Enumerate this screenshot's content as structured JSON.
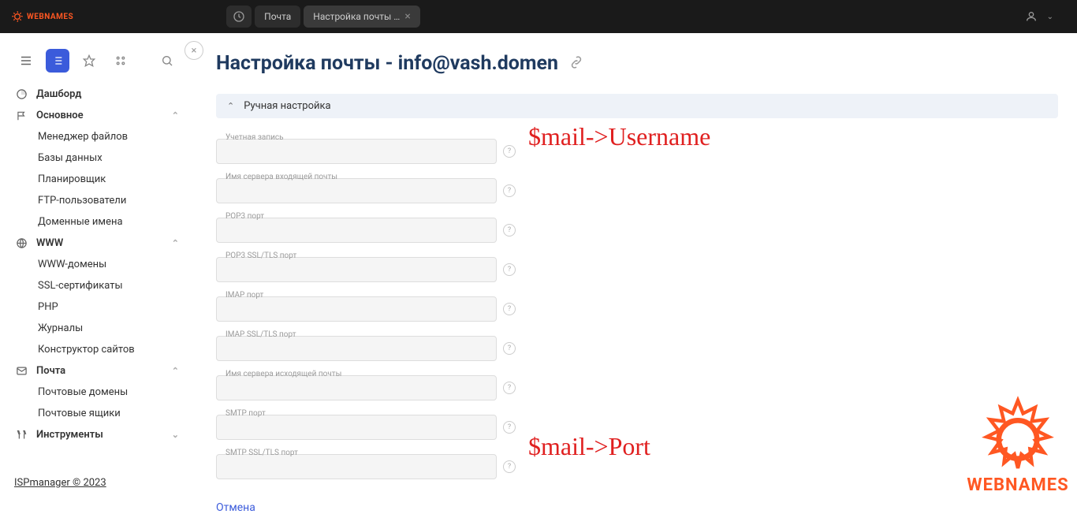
{
  "topbar": {
    "logo_text": "WEBNAMES",
    "tabs": [
      {
        "label": "Почта",
        "active": false
      },
      {
        "label": "Настройка почты …",
        "active": true
      }
    ]
  },
  "sidebar": {
    "dashboard": "Дашборд",
    "sections": [
      {
        "label": "Основное",
        "icon": "flag",
        "items": [
          "Менеджер файлов",
          "Базы данных",
          "Планировщик",
          "FTP-пользователи",
          "Доменные имена"
        ]
      },
      {
        "label": "WWW",
        "icon": "globe",
        "items": [
          "WWW-домены",
          "SSL-сертификаты",
          "PHP",
          "Журналы",
          "Конструктор сайтов"
        ]
      },
      {
        "label": "Почта",
        "icon": "mail",
        "items": [
          "Почтовые домены",
          "Почтовые ящики"
        ]
      },
      {
        "label": "Инструменты",
        "icon": "tools",
        "items": []
      }
    ],
    "footer": "ISPmanager © 2023"
  },
  "page": {
    "title": "Настройка почты - info@vash.domen",
    "accordion_title": "Ручная настройка",
    "fields": [
      {
        "label": "Учетная запись"
      },
      {
        "label": "Имя сервера входящей почты"
      },
      {
        "label": "POP3 порт"
      },
      {
        "label": "POP3 SSL/TLS порт"
      },
      {
        "label": "IMAP порт"
      },
      {
        "label": "IMAP SSL/TLS порт"
      },
      {
        "label": "Имя сервера исходящей почты"
      },
      {
        "label": "SMTP порт"
      },
      {
        "label": "SMTP SSL/TLS порт"
      }
    ],
    "cancel": "Отмена"
  },
  "annotations": {
    "username": "$mail->Username",
    "port": "$mail->Port"
  },
  "watermark": {
    "text": "WEBNAMES"
  }
}
